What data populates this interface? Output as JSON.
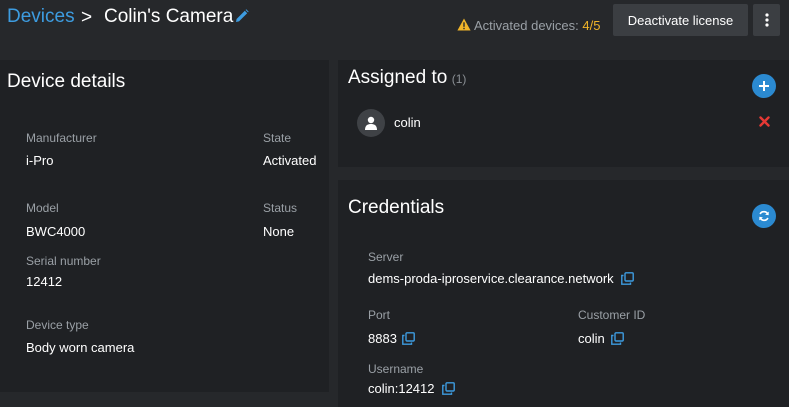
{
  "header": {
    "breadcrumb_link": "Devices",
    "breadcrumb_sep": ">",
    "title": "Colin's Camera",
    "activated_label": "Activated devices:",
    "activated_count": "4/5",
    "deactivate_label": "Deactivate license",
    "icons": {
      "edit": "pencil-icon",
      "warning": "warning-icon",
      "more": "more-vertical-icon"
    }
  },
  "device_details": {
    "heading": "Device details",
    "manufacturer": {
      "label": "Manufacturer",
      "value": "i-Pro"
    },
    "state": {
      "label": "State",
      "value": "Activated"
    },
    "model": {
      "label": "Model",
      "value": "BWC4000"
    },
    "status": {
      "label": "Status",
      "value": "None"
    },
    "serial": {
      "label": "Serial number",
      "value": "12412"
    },
    "device_type": {
      "label": "Device type",
      "value": "Body worn camera"
    }
  },
  "assigned": {
    "heading": "Assigned to",
    "count": "(1)",
    "user": "colin",
    "icons": {
      "add": "plus-icon",
      "avatar": "user-icon",
      "remove": "close-icon"
    }
  },
  "credentials": {
    "heading": "Credentials",
    "server": {
      "label": "Server",
      "value": "dems-proda-iproservice.clearance.network"
    },
    "port": {
      "label": "Port",
      "value": "8883"
    },
    "customer_id": {
      "label": "Customer ID",
      "value": "colin"
    },
    "username": {
      "label": "Username",
      "value": "colin:12412"
    },
    "icons": {
      "refresh": "refresh-icon",
      "copy": "copy-icon"
    }
  },
  "colors": {
    "accent": "#2b8ad1",
    "link": "#3d9ce0",
    "warning": "#f0b429",
    "danger": "#e53935"
  }
}
